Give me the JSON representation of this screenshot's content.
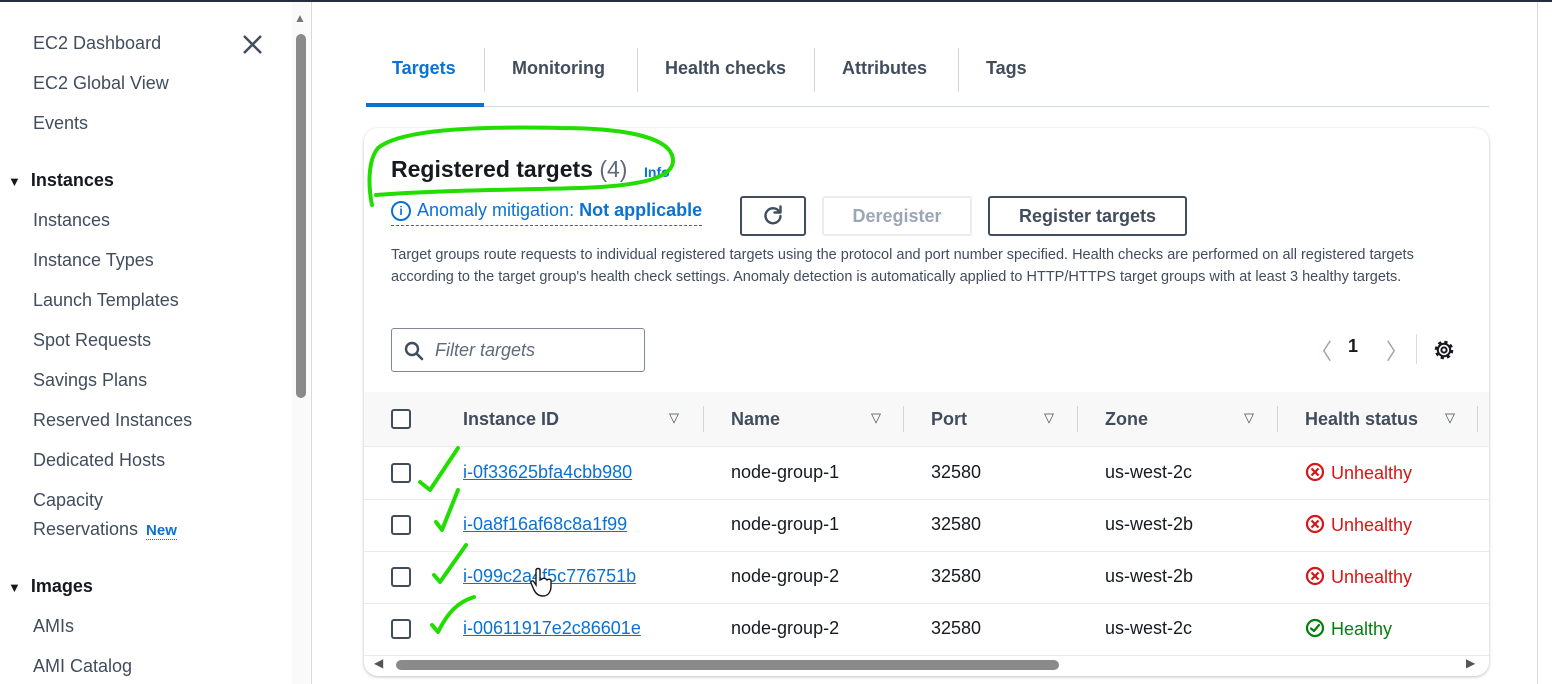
{
  "sidebar": {
    "items": [
      {
        "label": "EC2 Dashboard"
      },
      {
        "label": "EC2 Global View"
      },
      {
        "label": "Events"
      }
    ],
    "sections": [
      {
        "label": "Instances",
        "items": [
          {
            "label": "Instances"
          },
          {
            "label": "Instance Types"
          },
          {
            "label": "Launch Templates"
          },
          {
            "label": "Spot Requests"
          },
          {
            "label": "Savings Plans"
          },
          {
            "label": "Reserved Instances"
          },
          {
            "label": "Dedicated Hosts"
          },
          {
            "label": "Capacity"
          },
          {
            "label": "Reservations",
            "badge": "New"
          }
        ]
      },
      {
        "label": "Images",
        "items": [
          {
            "label": "AMIs"
          },
          {
            "label": "AMI Catalog"
          }
        ]
      }
    ]
  },
  "tabs": [
    {
      "label": "Targets",
      "active": true
    },
    {
      "label": "Monitoring"
    },
    {
      "label": "Health checks"
    },
    {
      "label": "Attributes"
    },
    {
      "label": "Tags"
    }
  ],
  "panel": {
    "title": "Registered targets",
    "count": "(4)",
    "info": "Info",
    "anomaly_label": "Anomaly mitigation:",
    "anomaly_value": "Not applicable",
    "deregister_label": "Deregister",
    "register_label": "Register targets",
    "description": "Target groups route requests to individual registered targets using the protocol and port number specified. Health checks are performed on all registered targets according to the target group's health check settings. Anomaly detection is automatically applied to HTTP/HTTPS target groups with at least 3 healthy targets.",
    "filter_placeholder": "Filter targets",
    "page_number": "1"
  },
  "table": {
    "columns": [
      "Instance ID",
      "Name",
      "Port",
      "Zone",
      "Health status"
    ],
    "rows": [
      {
        "instance_id": "i-0f33625bfa4cbb980",
        "name": "node-group-1",
        "port": "32580",
        "zone": "us-west-2c",
        "health": "Unhealthy"
      },
      {
        "instance_id": "i-0a8f16af68c8a1f99",
        "name": "node-group-1",
        "port": "32580",
        "zone": "us-west-2b",
        "health": "Unhealthy"
      },
      {
        "instance_id": "i-099c2a4f5c776751b",
        "name": "node-group-2",
        "port": "32580",
        "zone": "us-west-2b",
        "health": "Unhealthy"
      },
      {
        "instance_id": "i-00611917e2c86601e",
        "name": "node-group-2",
        "port": "32580",
        "zone": "us-west-2c",
        "health": "Healthy"
      }
    ]
  },
  "colors": {
    "link": "#0972d3",
    "unhealthy": "#d91515",
    "healthy": "#037f0c",
    "annotation": "#22dd00"
  },
  "icons": [
    "close-icon",
    "caret-down-icon",
    "info-icon",
    "refresh-icon",
    "search-icon",
    "chevron-left-icon",
    "chevron-right-icon",
    "gear-icon",
    "sort-icon",
    "error-icon",
    "success-icon",
    "hand-cursor-icon"
  ]
}
